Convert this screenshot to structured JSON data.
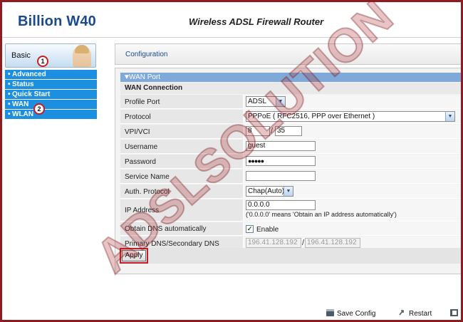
{
  "header": {
    "brand": "Billion W40",
    "router_title": "Wireless ADSL Firewall Router"
  },
  "sidebar": {
    "basic_label": "Basic",
    "items": [
      {
        "label": "Advanced"
      },
      {
        "label": "Status"
      },
      {
        "label": "Quick Start"
      },
      {
        "label": "WAN",
        "selected": true
      },
      {
        "label": "WLAN"
      }
    ],
    "bullet": "•"
  },
  "badges": {
    "one": "1",
    "two": "2"
  },
  "tabs": {
    "configuration": "Configuration"
  },
  "section": {
    "title": "WAN Port",
    "toggle_glyph": "▼",
    "group": "WAN Connection"
  },
  "form": {
    "profile_port": {
      "label": "Profile Port",
      "value": "ADSL"
    },
    "protocol": {
      "label": "Protocol",
      "value": "PPPoE ( RFC2516, PPP over Ethernet )"
    },
    "vpivci": {
      "label": "VPI/VCI",
      "vpi": "8",
      "separator": "/",
      "vci": "35"
    },
    "username": {
      "label": "Username",
      "value": "guest"
    },
    "password": {
      "label": "Password",
      "value": "●●●●●"
    },
    "service_name": {
      "label": "Service Name",
      "value": ""
    },
    "auth_protocol": {
      "label": "Auth. Protocol",
      "value": "Chap(Auto)"
    },
    "ip_address": {
      "label": "IP Address",
      "value": "0.0.0.0",
      "hint": "('0.0.0.0' means 'Obtain an IP address automatically')"
    },
    "obtain_dns": {
      "label": "Obtain DNS automatically",
      "checkbox_label": "Enable",
      "checked": true,
      "check_glyph": "✓"
    },
    "dns": {
      "label": "Primary DNS/Secondary DNS",
      "primary": "196.41.128.192",
      "separator": "/",
      "secondary": "196.41.128.192"
    }
  },
  "apply_label": "Apply",
  "select_arrow": "▼",
  "bottom": {
    "save_config": "Save Config",
    "restart": "Restart"
  },
  "watermark": "ADSLSOLUTION",
  "colors": {
    "border": "#8e1d21",
    "brand": "#1a4a8c",
    "menu": "#1d8fe0",
    "section": "#7fa9d9",
    "highlight": "#c81d25"
  }
}
